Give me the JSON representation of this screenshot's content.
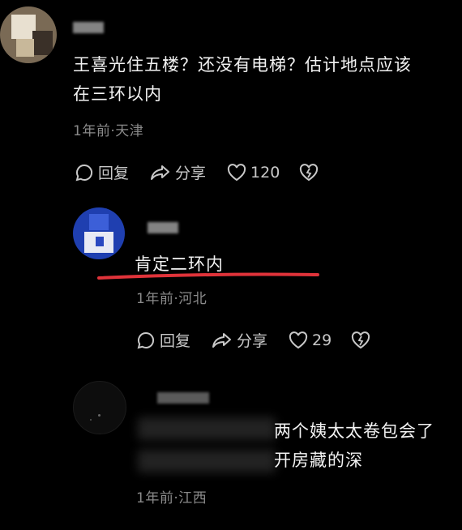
{
  "comments": [
    {
      "text_line1": "王喜光住五楼？还没有电梯？估计地点应该",
      "text_line2": "在三环以内",
      "meta": "1年前·天津",
      "actions": {
        "reply": "回复",
        "share": "分享",
        "likes": "120"
      }
    },
    {
      "text": "肯定二环内",
      "meta": "1年前·河北",
      "actions": {
        "reply": "回复",
        "share": "分享",
        "likes": "29"
      }
    },
    {
      "text_line1": "两个姨太太卷包会了",
      "text_line2": "开房藏的深",
      "meta": "1年前·江西"
    }
  ],
  "colors": {
    "background": "#000000",
    "underline": "#e0333a",
    "meta": "#8a8a8a"
  }
}
